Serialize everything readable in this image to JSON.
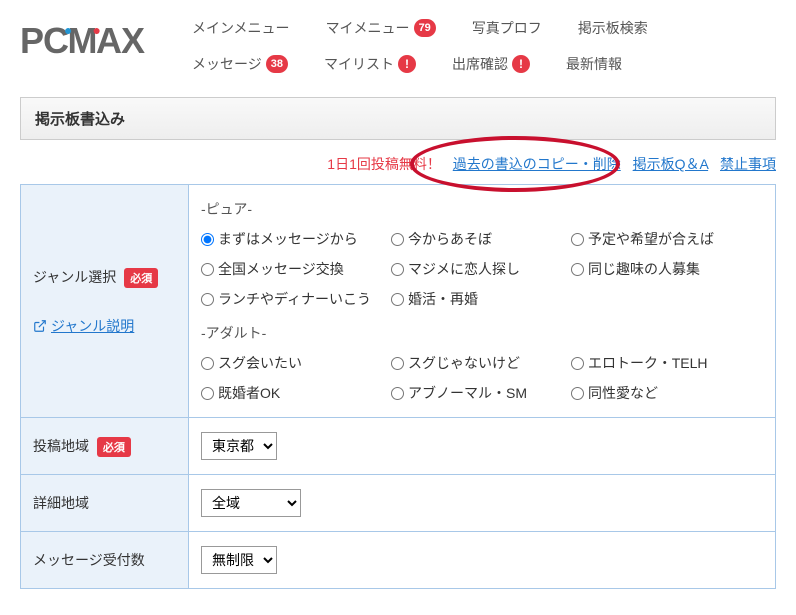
{
  "logo": {
    "text": "PCMAX"
  },
  "nav": {
    "row1": [
      {
        "label": "メインメニュー",
        "badge": null
      },
      {
        "label": "マイメニュー",
        "badge": "79"
      },
      {
        "label": "写真プロフ",
        "badge": null
      },
      {
        "label": "掲示板検索",
        "badge": null
      }
    ],
    "row2": [
      {
        "label": "メッセージ",
        "badge": "38"
      },
      {
        "label": "マイリスト",
        "badge": "!"
      },
      {
        "label": "出席確認",
        "badge": "!"
      },
      {
        "label": "最新情報",
        "badge": null
      }
    ]
  },
  "title": "掲示板書込み",
  "links_bar": {
    "free_text": "1日1回投稿無料！",
    "copy_delete": "過去の書込のコピー・削除",
    "qa": "掲示板Q＆A",
    "prohibited": "禁止事項"
  },
  "form": {
    "genre": {
      "label": "ジャンル選択",
      "required": "必須",
      "explain": "ジャンル説明",
      "pure_header": "-ピュア-",
      "adult_header": "-アダルト-",
      "pure": [
        "まずはメッセージから",
        "今からあそぼ",
        "予定や希望が合えば",
        "全国メッセージ交換",
        "マジメに恋人探し",
        "同じ趣味の人募集",
        "ランチやディナーいこう",
        "婚活・再婚"
      ],
      "adult": [
        "スグ会いたい",
        "スグじゃないけど",
        "エロトーク・TELH",
        "既婚者OK",
        "アブノーマル・SM",
        "同性愛など"
      ]
    },
    "region": {
      "label": "投稿地域",
      "required": "必須",
      "selected": "東京都"
    },
    "detail_region": {
      "label": "詳細地域",
      "selected": "全域"
    },
    "msg_count": {
      "label": "メッセージ受付数",
      "selected": "無制限"
    }
  }
}
